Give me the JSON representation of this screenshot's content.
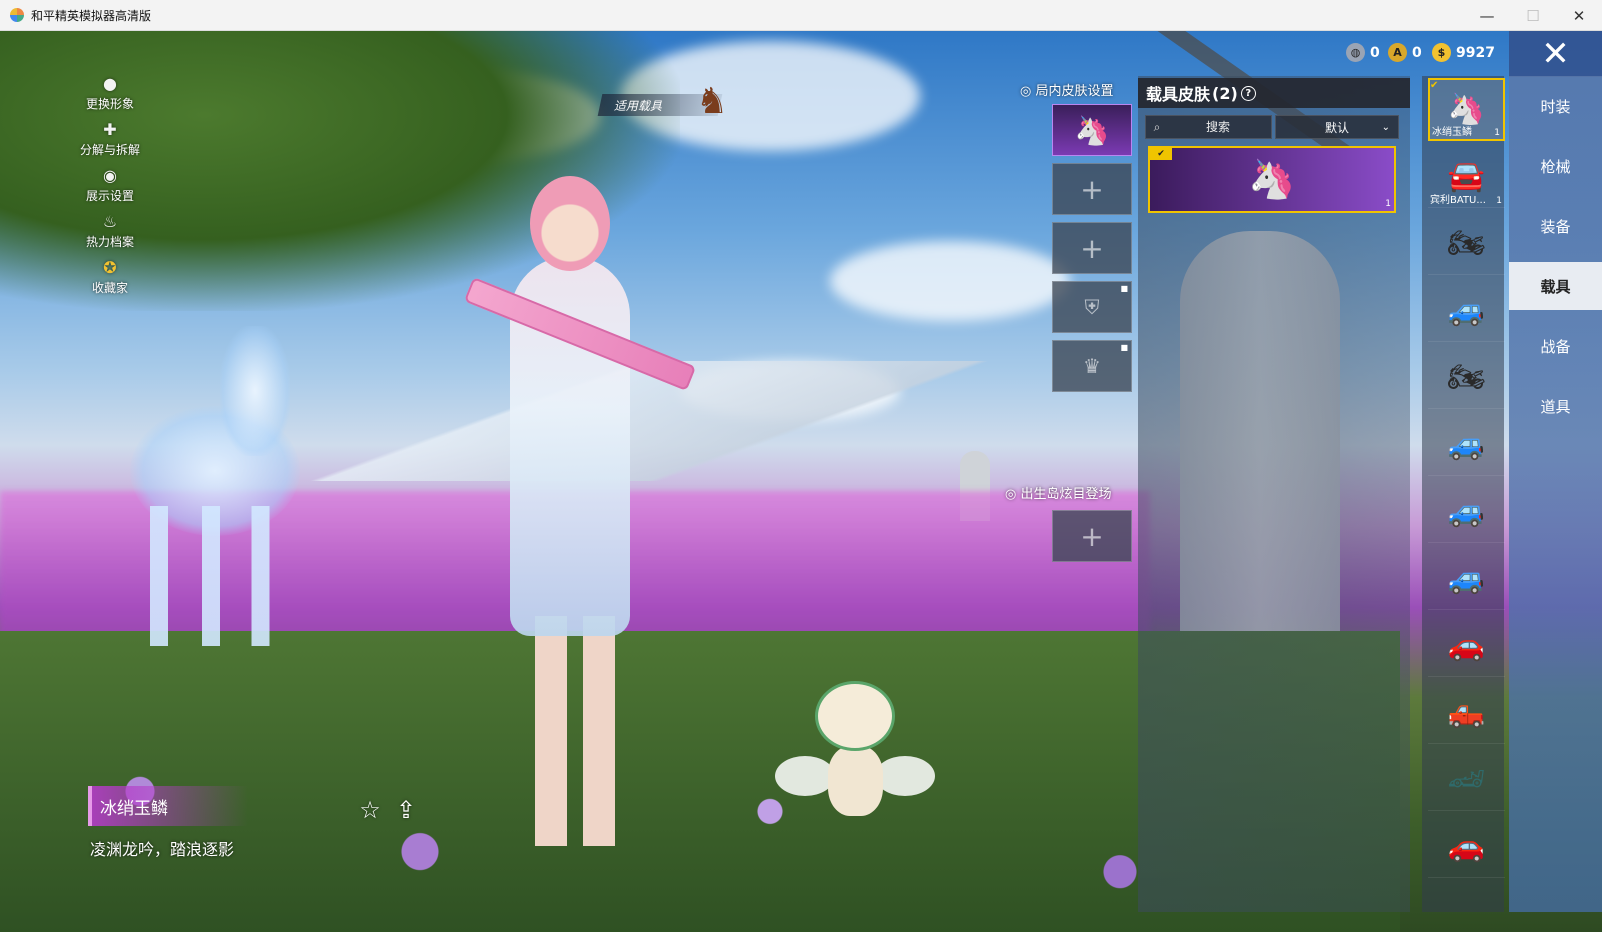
{
  "window": {
    "title": "和平精英模拟器高清版",
    "minimize": "—",
    "maximize": "☐",
    "close": "✕"
  },
  "left_menu": [
    {
      "label": "更换形象",
      "icon": "person-icon"
    },
    {
      "label": "分解与拆解",
      "icon": "puzzle-icon"
    },
    {
      "label": "展示设置",
      "icon": "eye-icon"
    },
    {
      "label": "热力档案",
      "icon": "flame-icon"
    },
    {
      "label": "收藏家",
      "icon": "badge-icon"
    }
  ],
  "apply_vehicle": {
    "label": "适用载具",
    "icon": "horse-icon"
  },
  "currency": [
    {
      "icon": "globe-coin-icon",
      "value": "0",
      "color": "#9aa4b4"
    },
    {
      "icon": "gold-a-coin-icon",
      "value": "0",
      "color": "#d9a82a"
    },
    {
      "icon": "gold-coin-icon",
      "value": "9927",
      "color": "#f2c230"
    }
  ],
  "ingame_skin": {
    "header": "局内皮肤设置",
    "slots": [
      {
        "state": "filled",
        "icon": "kirin-icon"
      },
      {
        "state": "empty",
        "icon": "plus-icon"
      },
      {
        "state": "empty",
        "icon": "plus-icon"
      },
      {
        "state": "locked",
        "icon": "shield-emblem-icon"
      },
      {
        "state": "locked",
        "icon": "crown-icon"
      }
    ]
  },
  "spawn_island": {
    "header": "出生岛炫目登场",
    "slot_icon": "plus-icon"
  },
  "vehicle_panel": {
    "title": "载具皮肤",
    "count": "(2)",
    "help_icon": "question-icon",
    "search_placeholder": "搜索",
    "sort_value": "默认",
    "selected_skin_count": "1"
  },
  "vehicles": [
    {
      "name": "冰绡玉鳞",
      "count": "1",
      "icon": "kirin-icon",
      "selected": true
    },
    {
      "name": "宾利BATU...",
      "count": "1",
      "icon": "pink-car-icon"
    },
    {
      "name": "",
      "count": "",
      "icon": "motorcycle-icon"
    },
    {
      "name": "",
      "count": "",
      "icon": "buggy-icon"
    },
    {
      "name": "",
      "count": "",
      "icon": "motorcycle-icon"
    },
    {
      "name": "",
      "count": "",
      "icon": "jeep-icon"
    },
    {
      "name": "",
      "count": "",
      "icon": "jeep-icon"
    },
    {
      "name": "",
      "count": "",
      "icon": "jeep-icon"
    },
    {
      "name": "",
      "count": "",
      "icon": "sedan-icon"
    },
    {
      "name": "",
      "count": "",
      "icon": "monster-truck-icon"
    },
    {
      "name": "",
      "count": "",
      "icon": "sports-car-icon"
    },
    {
      "name": "",
      "count": "",
      "icon": "muscle-car-icon"
    }
  ],
  "tabs": [
    {
      "label": "时装",
      "active": false
    },
    {
      "label": "枪械",
      "active": false
    },
    {
      "label": "装备",
      "active": false
    },
    {
      "label": "载具",
      "active": true
    },
    {
      "label": "战备",
      "active": false
    },
    {
      "label": "道具",
      "active": false
    }
  ],
  "close_icon": "close-icon",
  "item_info": {
    "name": "冰绡玉鳞",
    "description": "凌渊龙吟，踏浪逐影",
    "favorite_icon": "star-icon",
    "share_icon": "share-icon"
  }
}
